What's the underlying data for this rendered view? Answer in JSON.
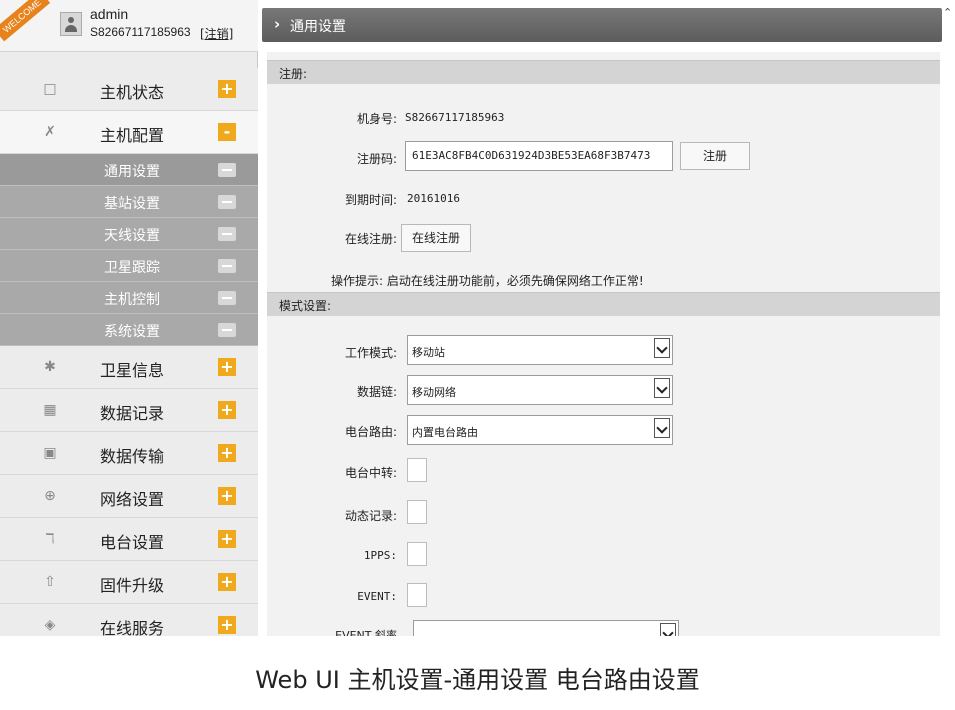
{
  "sidebar": {
    "welcome": "WELCOME",
    "username": "admin",
    "userid": "S82667117185963",
    "logout": "[注销]",
    "menu": [
      {
        "label": "主机状态",
        "icon": "monitor-icon",
        "toggle": "+"
      },
      {
        "label": "主机配置",
        "icon": "tools-icon",
        "toggle": "-"
      },
      {
        "label": "卫星信息",
        "icon": "satellite-icon",
        "toggle": "+"
      },
      {
        "label": "数据记录",
        "icon": "calendar-icon",
        "toggle": "+"
      },
      {
        "label": "数据传输",
        "icon": "network-icon",
        "toggle": "+"
      },
      {
        "label": "网络设置",
        "icon": "globe-icon",
        "toggle": "+"
      },
      {
        "label": "电台设置",
        "icon": "antenna-icon",
        "toggle": "+"
      },
      {
        "label": "固件升级",
        "icon": "upload-icon",
        "toggle": "+"
      },
      {
        "label": "在线服务",
        "icon": "service-icon",
        "toggle": "+"
      }
    ],
    "submenu": [
      "通用设置",
      "基站设置",
      "天线设置",
      "卫星跟踪",
      "主机控制",
      "系统设置"
    ]
  },
  "header": {
    "title": "通用设置"
  },
  "register": {
    "section": "注册:",
    "serial_label": "机身号:",
    "serial_value": "S82667117185963",
    "code_label": "注册码:",
    "code_value": "61E3AC8FB4C0D631924D3BE53EA68F3B7473",
    "register_button": "注册",
    "expire_label": "到期时间:",
    "expire_value": "20161016",
    "online_label": "在线注册:",
    "online_button": "在线注册",
    "hint": "操作提示: 启动在线注册功能前，必须先确保网络工作正常!"
  },
  "mode": {
    "section": "模式设置:",
    "work_label": "工作模式:",
    "work_value": "移动站",
    "datalink_label": "数据链:",
    "datalink_value": "移动网络",
    "radio_route_label": "电台路由:",
    "radio_route_value": "内置电台路由",
    "relay_label": "电台中转:",
    "dynamic_label": "动态记录:",
    "pps_label": "1PPS:",
    "event_label": "EVENT:",
    "cut_label": "EVENT 斜率"
  },
  "caption": "Web UI  主机设置-通用设置  电台路由设置"
}
